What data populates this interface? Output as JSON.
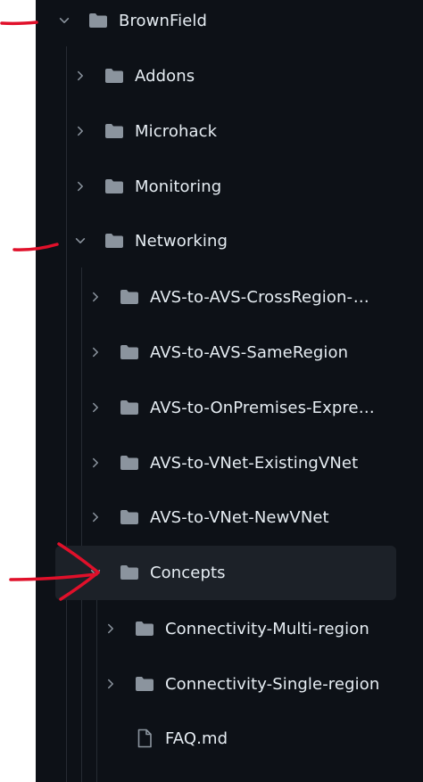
{
  "tree": {
    "items": [
      {
        "label": "BrownField",
        "icon": "folder-icon",
        "expanded": true
      },
      {
        "label": "Addons",
        "icon": "folder-icon",
        "expanded": false
      },
      {
        "label": "Microhack",
        "icon": "folder-icon",
        "expanded": false
      },
      {
        "label": "Monitoring",
        "icon": "folder-icon",
        "expanded": false
      },
      {
        "label": "Networking",
        "icon": "folder-icon",
        "expanded": true
      },
      {
        "label": "AVS-to-AVS-CrossRegion-Gl...",
        "icon": "folder-icon",
        "expanded": false
      },
      {
        "label": "AVS-to-AVS-SameRegion",
        "icon": "folder-icon",
        "expanded": false
      },
      {
        "label": "AVS-to-OnPremises-Express...",
        "icon": "folder-icon",
        "expanded": false
      },
      {
        "label": "AVS-to-VNet-ExistingVNet",
        "icon": "folder-icon",
        "expanded": false
      },
      {
        "label": "AVS-to-VNet-NewVNet",
        "icon": "folder-icon",
        "expanded": false
      },
      {
        "label": "Concepts",
        "icon": "folder-icon",
        "expanded": true,
        "selected": true
      },
      {
        "label": "Connectivity-Multi-region",
        "icon": "folder-icon",
        "expanded": false
      },
      {
        "label": "Connectivity-Single-region",
        "icon": "folder-icon",
        "expanded": false
      },
      {
        "label": "FAQ.md",
        "icon": "file-icon"
      }
    ]
  },
  "colors": {
    "background": "#0d1117",
    "text": "#e6edf3",
    "icon": "#8b949e",
    "selected_row": "#1c2128",
    "annotation": "#e0102a"
  }
}
